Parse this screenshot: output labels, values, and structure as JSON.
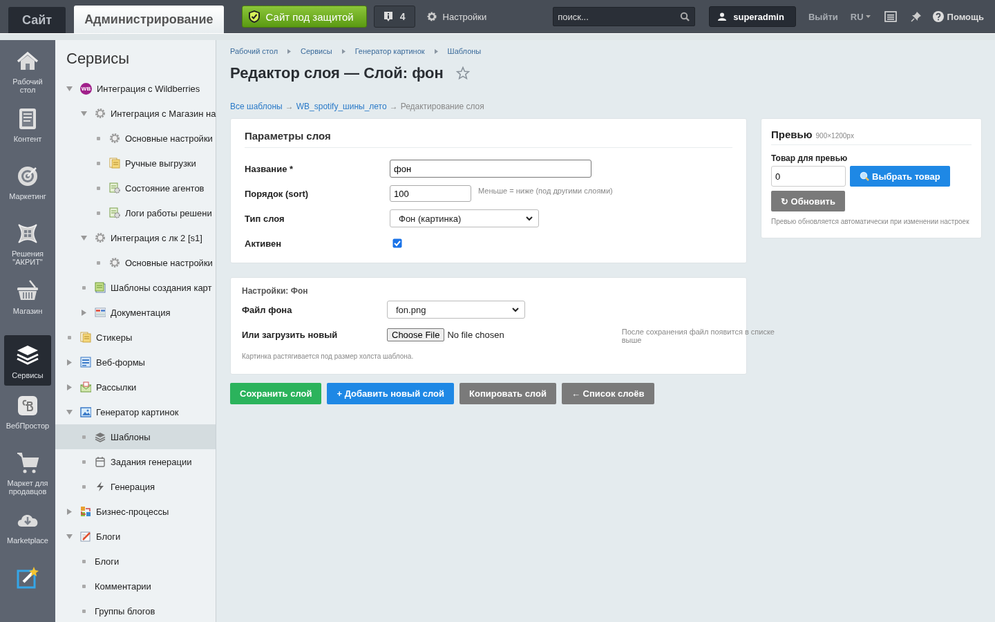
{
  "top_bar": {
    "tabs": [
      {
        "label": "Сайт",
        "selected": false
      },
      {
        "label": "Администрирование",
        "selected": true
      }
    ],
    "security_button": "Сайт под защитой",
    "notifications": "4",
    "settings": "Настройки",
    "search": {
      "placeholder": "поиск..."
    },
    "user": "superadmin",
    "logout": "Выйти",
    "language": "RU",
    "help": "Помощь"
  },
  "rail": [
    {
      "label": "Рабочий стол",
      "selected": false
    },
    {
      "label": "Контент",
      "selected": false
    },
    {
      "label": "Маркетинг",
      "selected": false
    },
    {
      "label": "Решения \"АКРИТ\"",
      "selected": false
    },
    {
      "label": "Магазин",
      "selected": false
    },
    {
      "label": "Сервисы",
      "selected": true
    },
    {
      "label": "ВебПростор",
      "selected": false
    },
    {
      "label": "Маркет для продавцов",
      "selected": false
    },
    {
      "label": "Marketplace",
      "selected": false
    },
    {
      "selected": false
    }
  ],
  "tree": {
    "title": "Сервисы",
    "items": [
      {
        "label": "Интеграция с Wildberries",
        "badge": "WB",
        "expanded": true,
        "selected": false,
        "children": [
          {
            "label": "Интеграция с Магазин на",
            "expanded": true,
            "selected": false,
            "children": [
              {
                "label": "Основные настройки",
                "selected": false
              },
              {
                "label": "Ручные выгрузки",
                "selected": false
              },
              {
                "label": "Состояние агентов",
                "selected": false
              },
              {
                "label": "Логи работы решени",
                "selected": false
              }
            ]
          },
          {
            "label": "Интеграция с лк 2 [s1]",
            "expanded": true,
            "selected": false,
            "children": [
              {
                "label": "Основные настройки",
                "selected": false
              }
            ]
          },
          {
            "label": "Шаблоны создания карт",
            "selected": false
          },
          {
            "label": "Документация",
            "expanded": false,
            "selected": false
          }
        ]
      },
      {
        "label": "Стикеры",
        "selected": false
      },
      {
        "label": "Веб-формы",
        "expanded": false,
        "selected": false
      },
      {
        "label": "Рассылки",
        "expanded": false,
        "selected": false
      },
      {
        "label": "Генератор картинок",
        "expanded": true,
        "selected": false,
        "children": [
          {
            "label": "Шаблоны",
            "selected": true
          },
          {
            "label": "Задания генерации",
            "selected": false
          },
          {
            "label": "Генерация",
            "selected": false
          }
        ]
      },
      {
        "label": "Бизнес-процессы",
        "expanded": false,
        "selected": false
      },
      {
        "label": "Блоги",
        "expanded": true,
        "selected": false,
        "children": [
          {
            "label": "Блоги",
            "selected": false
          },
          {
            "label": "Комментарии",
            "selected": false
          },
          {
            "label": "Группы блогов",
            "selected": false
          }
        ]
      }
    ]
  },
  "page": {
    "breadcrumbs": [
      "Рабочий стол",
      "Сервисы",
      "Генератор картинок",
      "Шаблоны"
    ],
    "title": "Редактор слоя — Слой: фон",
    "favorite": false,
    "path": {
      "links": [
        "Все шаблоны",
        "WB_spotify_шины_лето"
      ],
      "separator": "→",
      "current": "Редактирование слоя"
    },
    "layer_params": {
      "title": "Параметры слоя",
      "fields": [
        {
          "kind": "text",
          "label": "Название *",
          "value": "фон"
        },
        {
          "kind": "number",
          "label": "Порядок (sort)",
          "value": "100",
          "hint": "Меньше = ниже (под другими слоями)"
        },
        {
          "kind": "select",
          "label": "Тип слоя",
          "value": "Фон (картинка)"
        },
        {
          "kind": "checkbox",
          "label": "Активен",
          "checked": true
        }
      ]
    },
    "background_settings": {
      "title": "Настройки: Фон",
      "fields": [
        {
          "kind": "select",
          "label": "Файл фона",
          "value": "fon.png"
        },
        {
          "kind": "file",
          "label": "Или загрузить новый",
          "button": "Choose File",
          "status": "No file chosen",
          "hint": "После сохранения файл появится в списке выше"
        }
      ],
      "note": "Картинка растягивается под размер холста шаблона."
    },
    "actions": [
      {
        "label": "Сохранить слой",
        "color": "#2bb35c"
      },
      {
        "label": "+ Добавить новый слой",
        "color": "#1e88e5"
      },
      {
        "label": "Копировать слой",
        "color": "#7a7a7a"
      },
      {
        "label": "← Список слоёв",
        "color": "#7a7a7a"
      }
    ],
    "preview": {
      "title": "Превью",
      "size": "900×1200px",
      "product_label": "Товар для превью",
      "product_value": "0",
      "choose_button": "Выбрать товар",
      "refresh_button": "↻ Обновить",
      "note": "Превью обновляется автоматически при изменении настроек"
    }
  }
}
